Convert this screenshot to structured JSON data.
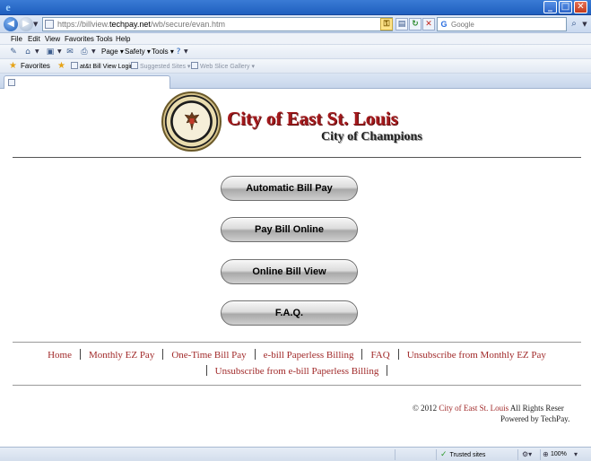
{
  "window": {
    "minimize": "_",
    "maximize": "□",
    "close": "✕"
  },
  "address": {
    "url_prefix": "https://billview.",
    "url_domain": "techpay.net",
    "url_path": "/wb/secure/evan.htm",
    "search_placeholder": "Google"
  },
  "menu": {
    "items": [
      "File",
      "Edit",
      "View",
      "Favorites",
      "Tools",
      "Help"
    ]
  },
  "command_bar": {
    "page": "Page",
    "safety": "Safety",
    "tools": "Tools"
  },
  "favorites_bar": {
    "label": "Favorites",
    "links": [
      "at&t Bill View Login",
      "Suggested Sites",
      "Web Slice Gallery"
    ]
  },
  "page": {
    "logo": {
      "title": "City of East St. Louis",
      "subtitle": "City of Champions"
    },
    "buttons": [
      "Automatic Bill Pay",
      "Pay Bill Online",
      "Online Bill View",
      "F.A.Q."
    ],
    "footer_links": [
      "Home",
      "Monthly EZ Pay",
      "One-Time Bill Pay",
      "e-bill Paperless Billing",
      "FAQ",
      "Unsubscribe from Monthly EZ Pay",
      "Unsubscribe from e-bill Paperless Billing"
    ],
    "copyright_prefix": "© 2012",
    "copyright_owner": "City of East St. Louis",
    "copyright_suffix": "All Rights Reser",
    "powered_by": "Powered by TechPay."
  },
  "status": {
    "zone": "Trusted sites",
    "zoom": "100%"
  }
}
